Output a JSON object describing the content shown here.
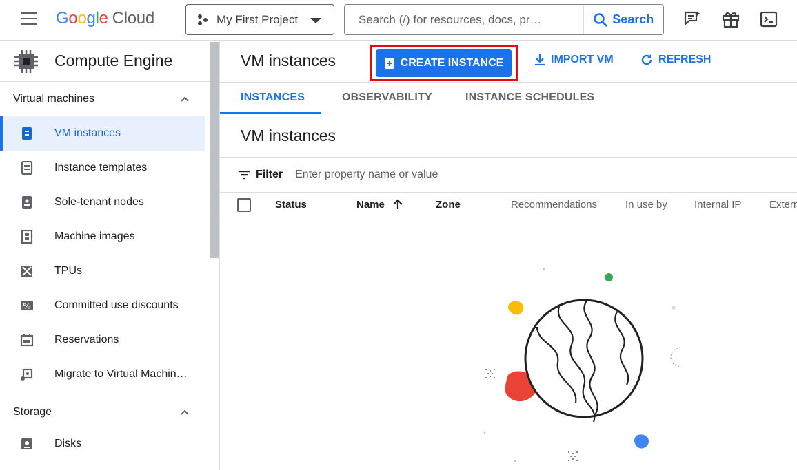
{
  "header": {
    "logo": {
      "google": [
        "G",
        "o",
        "o",
        "g",
        "l",
        "e"
      ],
      "cloud": "Cloud"
    },
    "project": "My First Project",
    "search_placeholder": "Search (/) for resources, docs, pr…",
    "search_button": "Search",
    "icons": [
      "menu-icon",
      "notes-icon",
      "gift-icon",
      "cloud-shell-icon"
    ]
  },
  "sidebar": {
    "product": "Compute Engine",
    "sections": [
      {
        "label": "Virtual machines",
        "items": [
          {
            "label": "VM instances",
            "icon": "vm-icon",
            "active": true
          },
          {
            "label": "Instance templates",
            "icon": "template-icon"
          },
          {
            "label": "Sole-tenant nodes",
            "icon": "node-icon"
          },
          {
            "label": "Machine images",
            "icon": "image-icon"
          },
          {
            "label": "TPUs",
            "icon": "tpu-icon"
          },
          {
            "label": "Committed use discounts",
            "icon": "percent-icon"
          },
          {
            "label": "Reservations",
            "icon": "calendar-icon"
          },
          {
            "label": "Migrate to Virtual Machin…",
            "icon": "migrate-icon"
          }
        ]
      },
      {
        "label": "Storage",
        "items": [
          {
            "label": "Disks",
            "icon": "disk-icon"
          }
        ]
      }
    ]
  },
  "main": {
    "title": "VM instances",
    "actions": {
      "create": "CREATE INSTANCE",
      "import": "IMPORT VM",
      "refresh": "REFRESH"
    },
    "tabs": [
      {
        "label": "INSTANCES",
        "active": true
      },
      {
        "label": "OBSERVABILITY"
      },
      {
        "label": "INSTANCE SCHEDULES"
      }
    ],
    "section_title": "VM instances",
    "filter_label": "Filter",
    "filter_placeholder": "Enter property name or value",
    "columns": [
      "Status",
      "Name",
      "Zone",
      "Recommendations",
      "In use by",
      "Internal IP",
      "Extern"
    ]
  },
  "colors": {
    "accent": "#1a73e8",
    "highlight_border": "#e50914",
    "active_bg": "#e8f0fe"
  }
}
